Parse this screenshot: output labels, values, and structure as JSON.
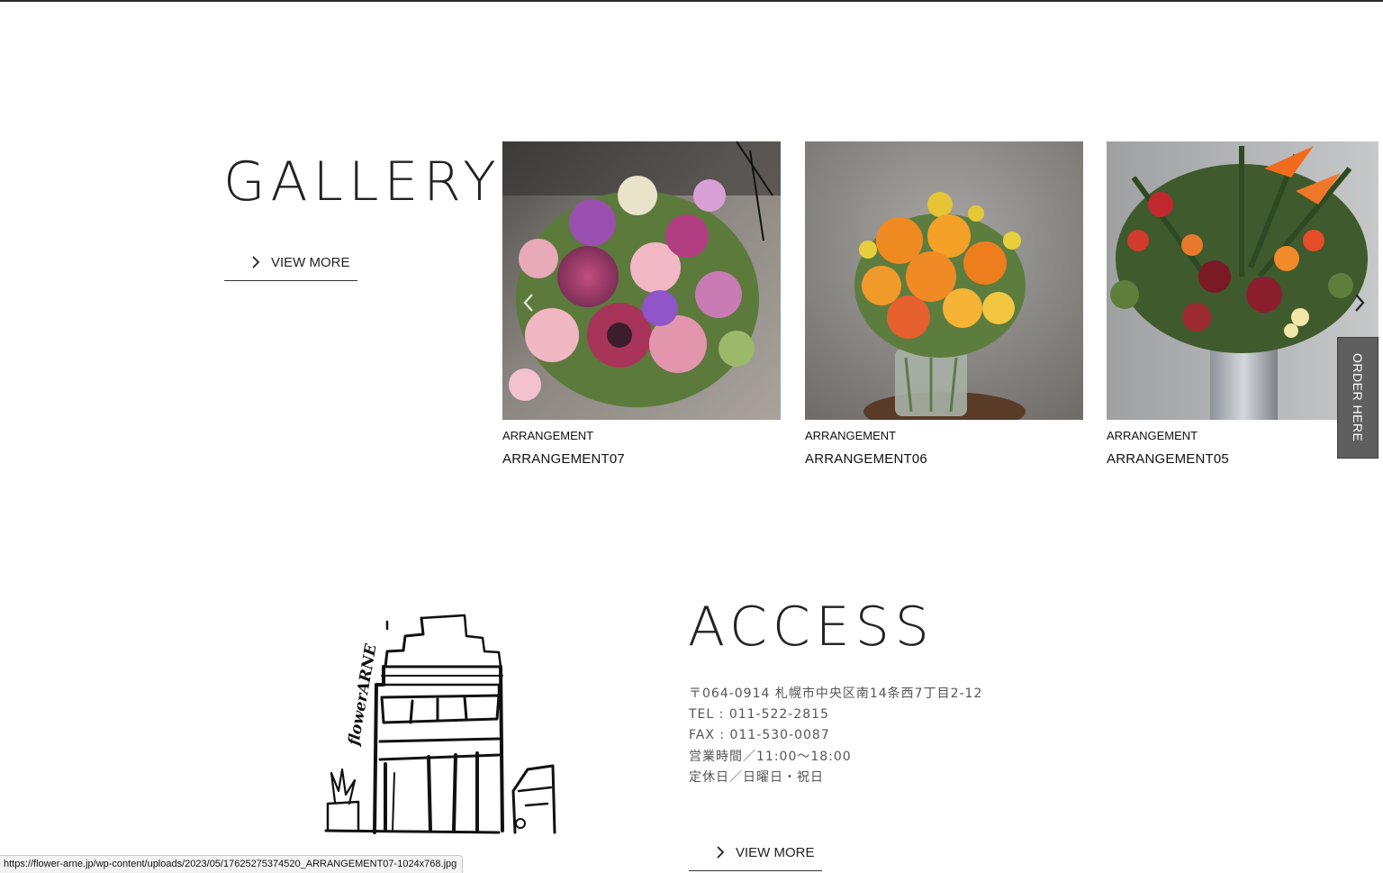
{
  "gallery": {
    "title": "GALLERY",
    "view_more_label": "VIEW MORE",
    "items": [
      {
        "category": "ARRANGEMENT",
        "name": "ARRANGEMENT07"
      },
      {
        "category": "ARRANGEMENT",
        "name": "ARRANGEMENT06"
      },
      {
        "category": "ARRANGEMENT",
        "name": "ARRANGEMENT05"
      }
    ]
  },
  "order_tab": {
    "label": "ORDER HERE"
  },
  "access": {
    "title": "ACCESS",
    "address_lines": [
      "〒064-0914 札幌市中央区南14条西7丁目2-12",
      "TEL : 011-522-2815",
      "FAX : 011-530-0087",
      "営業時間／11:00〜18:00",
      "定休日／日曜日・祝日"
    ],
    "view_more_label": "VIEW MORE",
    "illustration_text": "flowerARNE"
  },
  "status_bar": {
    "url": "https://flower-arne.jp/wp-content/uploads/2023/05/17625275374520_ARRANGEMENT07-1024x768.jpg"
  },
  "icons": {
    "view_more": "chevron-right-icon",
    "carousel_prev": "chevron-left-icon",
    "carousel_next": "chevron-right-icon"
  }
}
